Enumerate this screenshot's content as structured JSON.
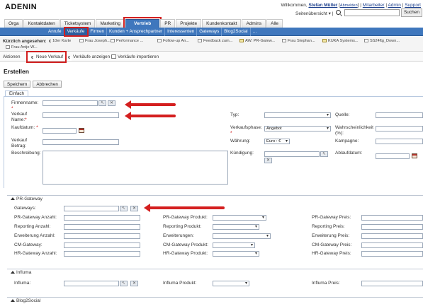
{
  "brand": {
    "logo_text": "ADENIN",
    "logo_accent": "#e07b00"
  },
  "user_bar": {
    "welcome": "Willkommen,",
    "user": "Stefan Müller",
    "logout": "Abmelden",
    "links": [
      "Mitarbeiter",
      "Admin",
      "Support"
    ],
    "view_label": "Seitenübersicht",
    "search_button": "Suchen",
    "search_value": ""
  },
  "main_nav": [
    "Orga",
    "Kontaktdaten",
    "Ticketsystem",
    "Marketing",
    "Vertrieb",
    "PR",
    "Projekte",
    "Kundenkontakt",
    "Admins",
    "Alle"
  ],
  "main_nav_active": "Vertrieb",
  "sub_nav": [
    "Anrufe",
    "Verkäufe",
    "Firmen",
    "Kunden + Ansprechpartner",
    "Interessenten",
    "Gateways",
    "Blog2Social"
  ],
  "sub_nav_active": "Verkäufe",
  "recent": {
    "label": "Kürzlich angesehen:",
    "items": [
      "10er Karte",
      "Frau Joseph...",
      "Performance ...",
      "Follow-up An...",
      "Feedback zum...",
      "AW: PR-Gatew...",
      "Frau Stephan...",
      "KUKA Systems...",
      "SS24ftg_Down...",
      "Frau Antje W..."
    ]
  },
  "actions": {
    "label": "Aktionen",
    "items": [
      "Neue Verkauf",
      "Verkäufe anzeigen",
      "Verkäufe importieren"
    ]
  },
  "page_title": "Erstellen",
  "buttons": {
    "save": "Speichern",
    "cancel": "Abbrechen"
  },
  "form_tab": "Einfach",
  "form": {
    "firmenname": "Firmenname:",
    "verkauf_name": "Verkauf Name:",
    "kaufdatum": "Kaufdatum:",
    "verkauf_betrag": "Verkauf Betrag:",
    "beschreibung": "Beschreibung:",
    "typ": "Typ:",
    "verkaufsphase": "Verkaufsphase:",
    "verkaufsphase_value": "Angebot",
    "waehrung": "Währung:",
    "waehrung_value": "Euro : €",
    "kuendigung": "Kündigung:",
    "quelle": "Quelle:",
    "wahrscheinlichkeit": "Wahrscheinlichkeit (%):",
    "kampagne": "Kampagne:",
    "ablaufdatum": "Ablaufdatum:"
  },
  "pr_gateway": {
    "title": "PR-Gateway",
    "gateways": "Gateways:",
    "col1": [
      "PR-Gateway Anzahl:",
      "Reporting Anzahl:",
      "Erweiterung Anzahl:",
      "CM-Gateway:",
      "HR-Gateway Anzahl:"
    ],
    "col2": [
      "PR-Gateway Produkt:",
      "Reporting Produkt:",
      "Erweiterungen:",
      "CM-Gateway Produkt:",
      "HR-Gateway Produkt:"
    ],
    "col3": [
      "PR-Gateway Preis:",
      "Reporting Preis:",
      "Erweiterung Preis:",
      "CM-Gateway Preis:",
      "HR-Gateway Preis:"
    ]
  },
  "influma": {
    "title": "Influma",
    "field1": "Influma:",
    "field2": "Influma Produkt:",
    "field3": "Influma Preis:"
  },
  "blog2social": {
    "title": "Blog2Social"
  },
  "annotation_color": "#d41f1f"
}
